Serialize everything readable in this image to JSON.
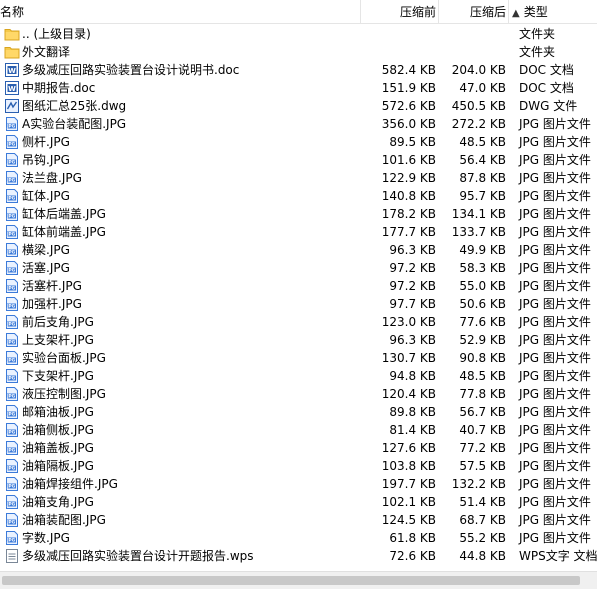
{
  "columns": {
    "name": "名称",
    "compressed": "压缩前",
    "after": "压缩后",
    "type": "类型",
    "sort_indicator": "▲"
  },
  "rows": [
    {
      "name": ".. (上级目录)",
      "compressed": "",
      "after": "",
      "type": "文件夹",
      "icon": "folder"
    },
    {
      "name": "外文翻译",
      "compressed": "",
      "after": "",
      "type": "文件夹",
      "icon": "folder"
    },
    {
      "name": "多级减压回路实验装置台设计说明书.doc",
      "compressed": "582.4 KB",
      "after": "204.0 KB",
      "type": "DOC 文档",
      "icon": "doc"
    },
    {
      "name": "中期报告.doc",
      "compressed": "151.9 KB",
      "after": "47.0 KB",
      "type": "DOC 文档",
      "icon": "doc"
    },
    {
      "name": "图纸汇总25张.dwg",
      "compressed": "572.6 KB",
      "after": "450.5 KB",
      "type": "DWG 文件",
      "icon": "dwg"
    },
    {
      "name": "A实验台装配图.JPG",
      "compressed": "356.0 KB",
      "after": "272.2 KB",
      "type": "JPG 图片文件",
      "icon": "jpg"
    },
    {
      "name": "侧杆.JPG",
      "compressed": "89.5 KB",
      "after": "48.5 KB",
      "type": "JPG 图片文件",
      "icon": "jpg"
    },
    {
      "name": "吊钩.JPG",
      "compressed": "101.6 KB",
      "after": "56.4 KB",
      "type": "JPG 图片文件",
      "icon": "jpg"
    },
    {
      "name": "法兰盘.JPG",
      "compressed": "122.9 KB",
      "after": "87.8 KB",
      "type": "JPG 图片文件",
      "icon": "jpg"
    },
    {
      "name": "缸体.JPG",
      "compressed": "140.8 KB",
      "after": "95.7 KB",
      "type": "JPG 图片文件",
      "icon": "jpg"
    },
    {
      "name": "缸体后端盖.JPG",
      "compressed": "178.2 KB",
      "after": "134.1 KB",
      "type": "JPG 图片文件",
      "icon": "jpg"
    },
    {
      "name": "缸体前端盖.JPG",
      "compressed": "177.7 KB",
      "after": "133.7 KB",
      "type": "JPG 图片文件",
      "icon": "jpg"
    },
    {
      "name": "横梁.JPG",
      "compressed": "96.3 KB",
      "after": "49.9 KB",
      "type": "JPG 图片文件",
      "icon": "jpg"
    },
    {
      "name": "活塞.JPG",
      "compressed": "97.2 KB",
      "after": "58.3 KB",
      "type": "JPG 图片文件",
      "icon": "jpg"
    },
    {
      "name": "活塞杆.JPG",
      "compressed": "97.2 KB",
      "after": "55.0 KB",
      "type": "JPG 图片文件",
      "icon": "jpg"
    },
    {
      "name": "加强杆.JPG",
      "compressed": "97.7 KB",
      "after": "50.6 KB",
      "type": "JPG 图片文件",
      "icon": "jpg"
    },
    {
      "name": "前后支角.JPG",
      "compressed": "123.0 KB",
      "after": "77.6 KB",
      "type": "JPG 图片文件",
      "icon": "jpg"
    },
    {
      "name": "上支架杆.JPG",
      "compressed": "96.3 KB",
      "after": "52.9 KB",
      "type": "JPG 图片文件",
      "icon": "jpg"
    },
    {
      "name": "实验台面板.JPG",
      "compressed": "130.7 KB",
      "after": "90.8 KB",
      "type": "JPG 图片文件",
      "icon": "jpg"
    },
    {
      "name": "下支架杆.JPG",
      "compressed": "94.8 KB",
      "after": "48.5 KB",
      "type": "JPG 图片文件",
      "icon": "jpg"
    },
    {
      "name": "液压控制图.JPG",
      "compressed": "120.4 KB",
      "after": "77.8 KB",
      "type": "JPG 图片文件",
      "icon": "jpg"
    },
    {
      "name": "邮箱油板.JPG",
      "compressed": "89.8 KB",
      "after": "56.7 KB",
      "type": "JPG 图片文件",
      "icon": "jpg"
    },
    {
      "name": "油箱侧板.JPG",
      "compressed": "81.4 KB",
      "after": "40.7 KB",
      "type": "JPG 图片文件",
      "icon": "jpg"
    },
    {
      "name": "油箱盖板.JPG",
      "compressed": "127.6 KB",
      "after": "77.2 KB",
      "type": "JPG 图片文件",
      "icon": "jpg"
    },
    {
      "name": "油箱隔板.JPG",
      "compressed": "103.8 KB",
      "after": "57.5 KB",
      "type": "JPG 图片文件",
      "icon": "jpg"
    },
    {
      "name": "油箱焊接组件.JPG",
      "compressed": "197.7 KB",
      "after": "132.2 KB",
      "type": "JPG 图片文件",
      "icon": "jpg"
    },
    {
      "name": "油箱支角.JPG",
      "compressed": "102.1 KB",
      "after": "51.4 KB",
      "type": "JPG 图片文件",
      "icon": "jpg"
    },
    {
      "name": "油箱装配图.JPG",
      "compressed": "124.5 KB",
      "after": "68.7 KB",
      "type": "JPG 图片文件",
      "icon": "jpg"
    },
    {
      "name": "字数.JPG",
      "compressed": "61.8 KB",
      "after": "55.2 KB",
      "type": "JPG 图片文件",
      "icon": "jpg"
    },
    {
      "name": "多级减压回路实验装置台设计开题报告.wps",
      "compressed": "72.6 KB",
      "after": "44.8 KB",
      "type": "WPS文字 文档",
      "icon": "wps"
    }
  ]
}
